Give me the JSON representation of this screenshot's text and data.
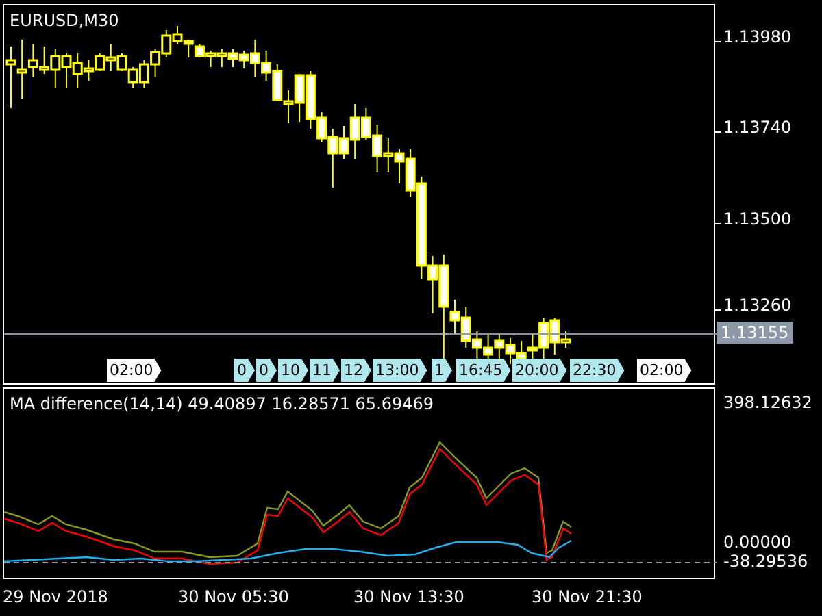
{
  "main_chart": {
    "symbol_label": "EURUSD,M30",
    "current_price": "1.13155",
    "price_scale": [
      "1.13980",
      "1.13740",
      "1.13500",
      "1.13260"
    ],
    "time_tags": [
      {
        "label": "02:00",
        "highlighted": false
      },
      {
        "label": "0",
        "highlighted": true
      },
      {
        "label": "0",
        "highlighted": true
      },
      {
        "label": "10",
        "highlighted": true
      },
      {
        "label": "11",
        "highlighted": true
      },
      {
        "label": "12",
        "highlighted": true
      },
      {
        "label": "13:00",
        "highlighted": true
      },
      {
        "label": "1",
        "highlighted": true
      },
      {
        "label": "16:45",
        "highlighted": true
      },
      {
        "label": "20:00",
        "highlighted": true
      },
      {
        "label": "22:30",
        "highlighted": true
      },
      {
        "label": "02:00",
        "highlighted": false
      }
    ]
  },
  "indicator": {
    "label": "MA difference(14,14) 49.40897 16.28571 65.69469",
    "scale": [
      "398.12632",
      "0.00000",
      "-38.29536"
    ]
  },
  "time_axis": [
    "29 Nov 2018",
    "30 Nov 05:30",
    "30 Nov 13:30",
    "30 Nov 21:30"
  ]
}
